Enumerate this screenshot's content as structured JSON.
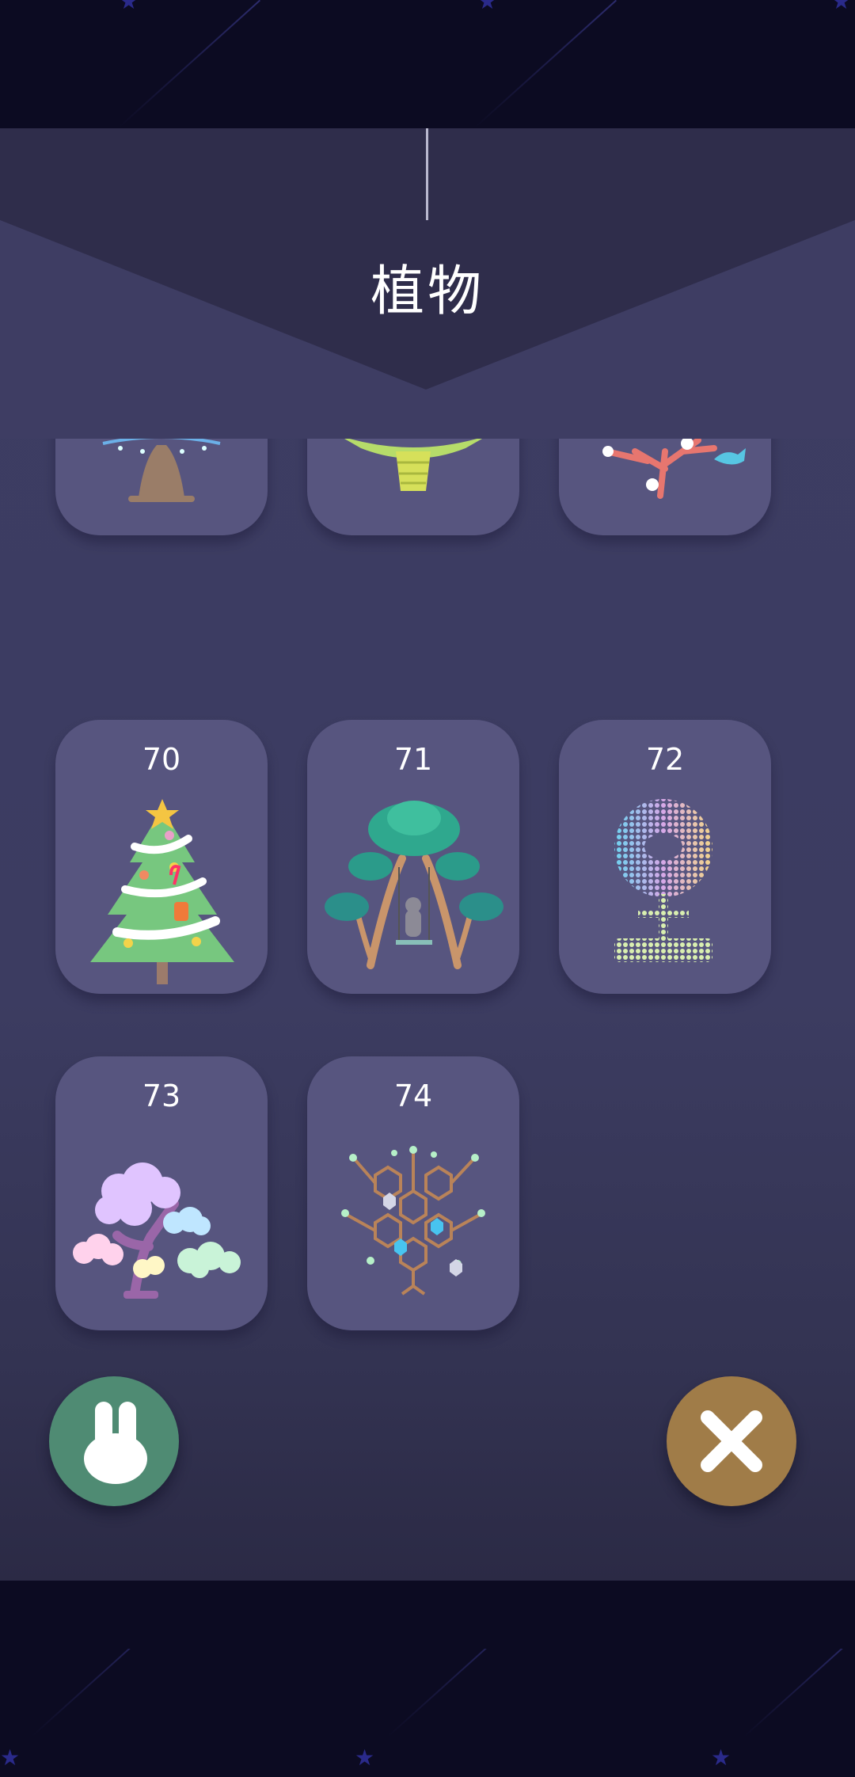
{
  "header": {
    "title": "植物"
  },
  "cards_top_partial": [
    {
      "plant": "ferris-tree-icon"
    },
    {
      "plant": "glowing-palm-icon"
    },
    {
      "plant": "coral-tree-icon"
    }
  ],
  "cards": [
    {
      "number": "70",
      "plant": "christmas-tree-icon"
    },
    {
      "number": "71",
      "plant": "swing-tree-icon"
    },
    {
      "number": "72",
      "plant": "dot-flower-icon"
    },
    {
      "number": "73",
      "plant": "cloud-bonsai-icon"
    },
    {
      "number": "74",
      "plant": "honeycomb-tree-icon"
    }
  ],
  "buttons": {
    "left": {
      "icon": "rabbit-icon",
      "color": "#4f8b73"
    },
    "right": {
      "icon": "close-icon",
      "color": "#a07c48"
    }
  },
  "colors": {
    "background_space": "#0c0b22",
    "panel": "#3d3d63",
    "card": "#57557f"
  }
}
